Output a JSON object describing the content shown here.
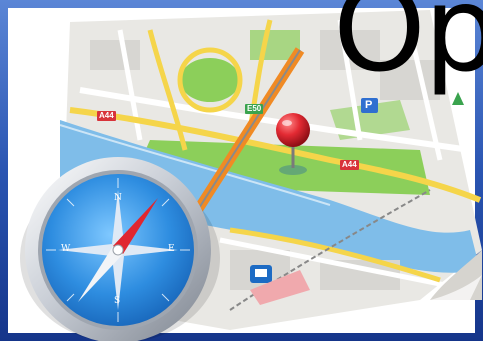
{
  "title": "Op",
  "road_labels": {
    "a44_left": "A44",
    "e50": "E50",
    "a44_right": "A44"
  },
  "parking_label": "P",
  "compass": {
    "north": "N",
    "south": "S",
    "east": "E",
    "west": "W"
  },
  "colors": {
    "map_paper": "#e9e8e4",
    "park_green": "#8ccf5a",
    "water_blue": "#7fbde9",
    "road_yellow": "#f5d54a",
    "highway_orange": "#f08a24",
    "road_badge_red": "#d8333a",
    "road_badge_green": "#3aa34e",
    "pin_red": "#d9202b",
    "compass_blue": "#2f8fd8",
    "frame_blue": "#1d3f8f"
  },
  "icons": [
    "map-icon",
    "compass-icon",
    "map-pin-icon",
    "parking-icon",
    "train-station-icon",
    "page-curl-icon"
  ]
}
